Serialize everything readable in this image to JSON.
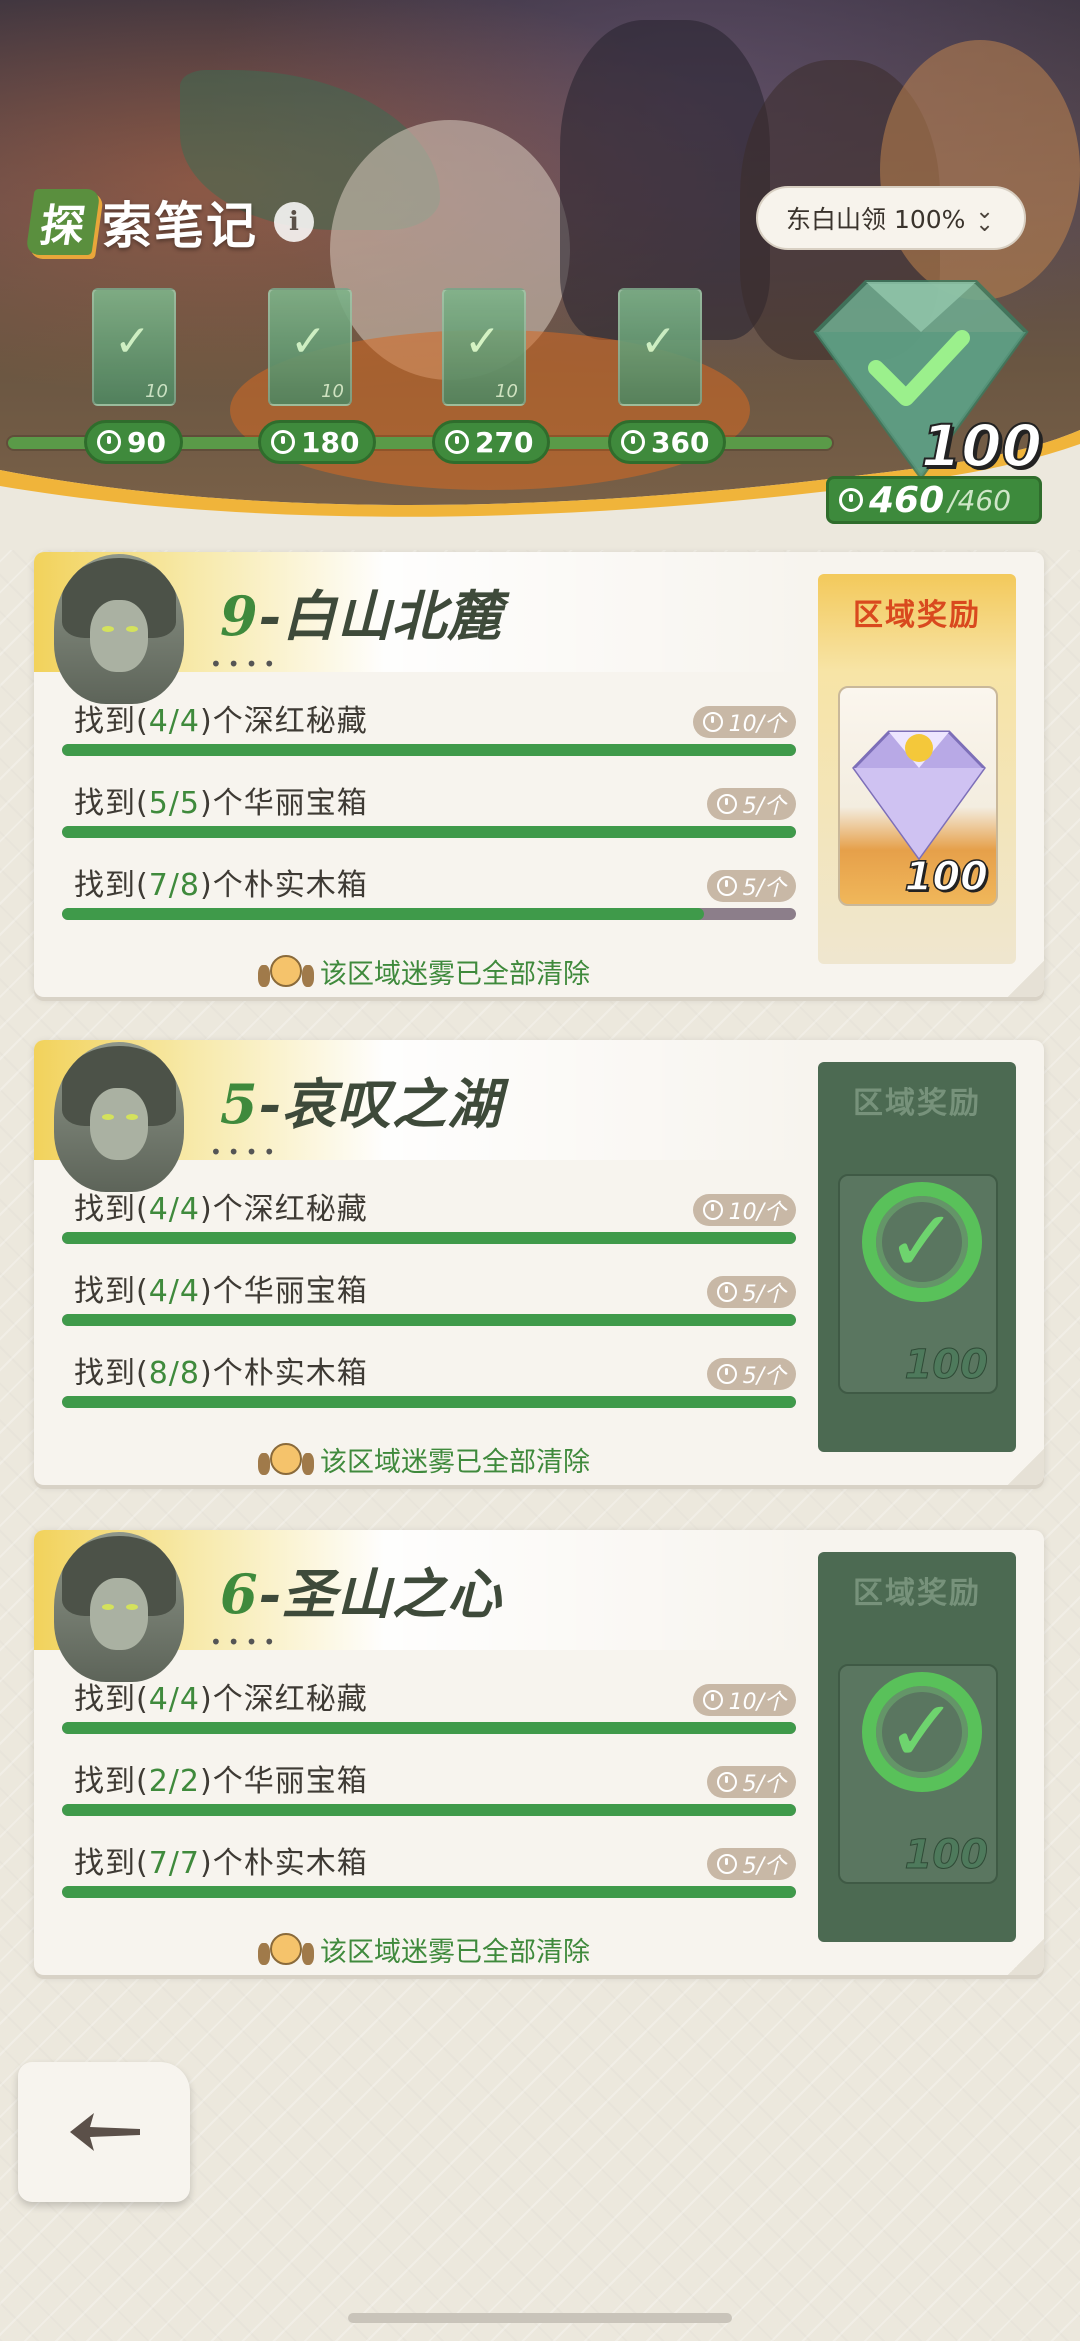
{
  "header": {
    "title_first": "探",
    "title_rest": "索笔记",
    "info_label": "i",
    "region_select": "东白山领 100%"
  },
  "milestones": [
    {
      "points": "90",
      "card_qty": "10",
      "claimed": true
    },
    {
      "points": "180",
      "card_qty": "10",
      "claimed": true
    },
    {
      "points": "270",
      "card_qty": "10",
      "claimed": true
    },
    {
      "points": "360",
      "card_qty": "",
      "claimed": true
    }
  ],
  "final_reward": {
    "qty": "100",
    "claimed": true
  },
  "total": {
    "current": "460",
    "max": "/460"
  },
  "areas": [
    {
      "number": "9",
      "name": "-白山北麓",
      "dots": "••••",
      "tasks": [
        {
          "prefix": "找到(",
          "count": "4/4",
          "suffix": ")个深红秘藏",
          "reward": "10/个",
          "progress": 1.0
        },
        {
          "prefix": "找到(",
          "count": "5/5",
          "suffix": ")个华丽宝箱",
          "reward": "5/个",
          "progress": 1.0
        },
        {
          "prefix": "找到(",
          "count": "7/8",
          "suffix": ")个朴实木箱",
          "reward": "5/个",
          "progress": 0.875
        }
      ],
      "cleared_text": "该区域迷雾已全部清除",
      "reward_title": "区域奖励",
      "reward_qty": "100",
      "reward_claimed": false
    },
    {
      "number": "5",
      "name": "-哀叹之湖",
      "dots": "••••",
      "tasks": [
        {
          "prefix": "找到(",
          "count": "4/4",
          "suffix": ")个深红秘藏",
          "reward": "10/个",
          "progress": 1.0
        },
        {
          "prefix": "找到(",
          "count": "4/4",
          "suffix": ")个华丽宝箱",
          "reward": "5/个",
          "progress": 1.0
        },
        {
          "prefix": "找到(",
          "count": "8/8",
          "suffix": ")个朴实木箱",
          "reward": "5/个",
          "progress": 1.0
        }
      ],
      "cleared_text": "该区域迷雾已全部清除",
      "reward_title": "区域奖励",
      "reward_qty": "100",
      "reward_claimed": true
    },
    {
      "number": "6",
      "name": "-圣山之心",
      "dots": "••••",
      "tasks": [
        {
          "prefix": "找到(",
          "count": "4/4",
          "suffix": ")个深红秘藏",
          "reward": "10/个",
          "progress": 1.0
        },
        {
          "prefix": "找到(",
          "count": "2/2",
          "suffix": ")个华丽宝箱",
          "reward": "5/个",
          "progress": 1.0
        },
        {
          "prefix": "找到(",
          "count": "7/7",
          "suffix": ")个朴实木箱",
          "reward": "5/个",
          "progress": 1.0
        }
      ],
      "cleared_text": "该区域迷雾已全部清除",
      "reward_title": "区域奖励",
      "reward_qty": "100",
      "reward_claimed": true
    }
  ],
  "colors": {
    "accent_green": "#3f8a3c",
    "reward_red": "#d9491e",
    "gold": "#f2d25b"
  },
  "icons": {
    "back": "back-arrow-icon",
    "points": "stopwatch-icon",
    "gem": "diamond-gem-icon",
    "check": "check-icon"
  }
}
